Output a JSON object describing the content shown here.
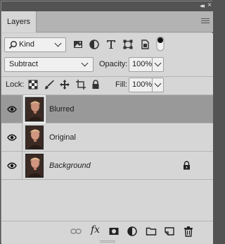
{
  "panel": {
    "tab_label": "Layers",
    "collapse_glyph": "◂◂",
    "close_glyph": "×"
  },
  "filter": {
    "kind_label": "Kind",
    "icons": [
      "image-filter-icon",
      "adjustment-filter-icon",
      "type-filter-icon",
      "shape-filter-icon",
      "smart-object-filter-icon",
      "filter-toggle-icon"
    ]
  },
  "blend": {
    "mode": "Subtract",
    "opacity_label": "Opacity:",
    "opacity_value": "100%"
  },
  "lock": {
    "label": "Lock:",
    "icons": [
      "lock-transparent-pixels-icon",
      "lock-image-pixels-icon",
      "lock-position-icon",
      "lock-artboard-icon",
      "lock-all-icon"
    ],
    "fill_label": "Fill:",
    "fill_value": "100%"
  },
  "layers": [
    {
      "name": "Blurred",
      "selected": true,
      "visible": true,
      "italic": false,
      "locked": false
    },
    {
      "name": "Original",
      "selected": false,
      "visible": true,
      "italic": false,
      "locked": false
    },
    {
      "name": "Background",
      "selected": false,
      "visible": true,
      "italic": true,
      "locked": true
    }
  ],
  "bottom_toolbar": {
    "icons": [
      "link-layers-icon",
      "fx-icon",
      "add-mask-icon",
      "new-adjustment-layer-icon",
      "new-group-icon",
      "new-layer-icon",
      "delete-layer-icon"
    ],
    "fx_label": "fx"
  },
  "colors": {
    "panel_bg": "#d6d6d6",
    "selected_row": "#999999",
    "chrome_dark": "#535353"
  }
}
